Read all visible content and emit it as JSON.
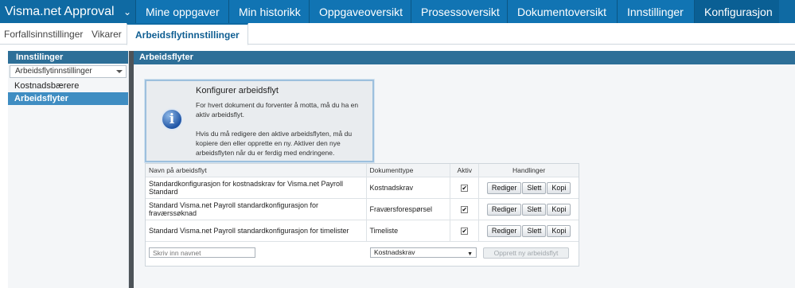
{
  "app": {
    "title": "Visma.net Approval",
    "chevron": "chevron-down-icon"
  },
  "nav": [
    "Mine oppgaver",
    "Min historikk",
    "Oppgaveoversikt",
    "Prosessoversikt",
    "Dokumentoversikt",
    "Innstillinger",
    "Konfigurasjon"
  ],
  "subtabs": [
    "Forfallsinnstillinger",
    "Vikarer",
    "Arbeidsflytinnstillinger"
  ],
  "left": {
    "header": "Innstilinger",
    "select": "Arbeidsflytinnstillinger",
    "items": [
      "Kostnadsbærere",
      "Arbeidsflyter"
    ]
  },
  "main": {
    "header": "Arbeidsflyter",
    "info": {
      "title": "Konfigurer arbeidsflyt",
      "p1": "For hvert dokument du forventer å motta, må du ha en aktiv arbeidsflyt.",
      "p2": "Hvis du må redigere den aktive arbeidsflyten, må du kopiere den eller opprette en ny. Aktiver den nye arbeidsflyten når du er ferdig med endringene.",
      "icon": "info-icon"
    },
    "table": {
      "headers": [
        "Navn på arbeidsflyt",
        "Dokumenttype",
        "Aktiv",
        "Handlinger"
      ],
      "rows": [
        {
          "name": "Standardkonfigurasjon for kostnadskrav for Visma.net Payroll Standard",
          "type": "Kostnadskrav",
          "active": "✔"
        },
        {
          "name": "Standard Visma.net Payroll standardkonfigurasjon for fraværssøknad",
          "type": "Fraværsforespørsel",
          "active": "✔"
        },
        {
          "name": "Standard Visma.net Payroll standardkonfigurasjon for timelister",
          "type": "Timeliste",
          "active": "✔"
        }
      ],
      "actions": [
        "Rediger",
        "Slett",
        "Kopi"
      ]
    },
    "footer": {
      "name_placeholder": "Skriv inn navnet",
      "type_value": "Kostnadskrav",
      "create_label": "Opprett ny arbeidsflyt"
    }
  }
}
